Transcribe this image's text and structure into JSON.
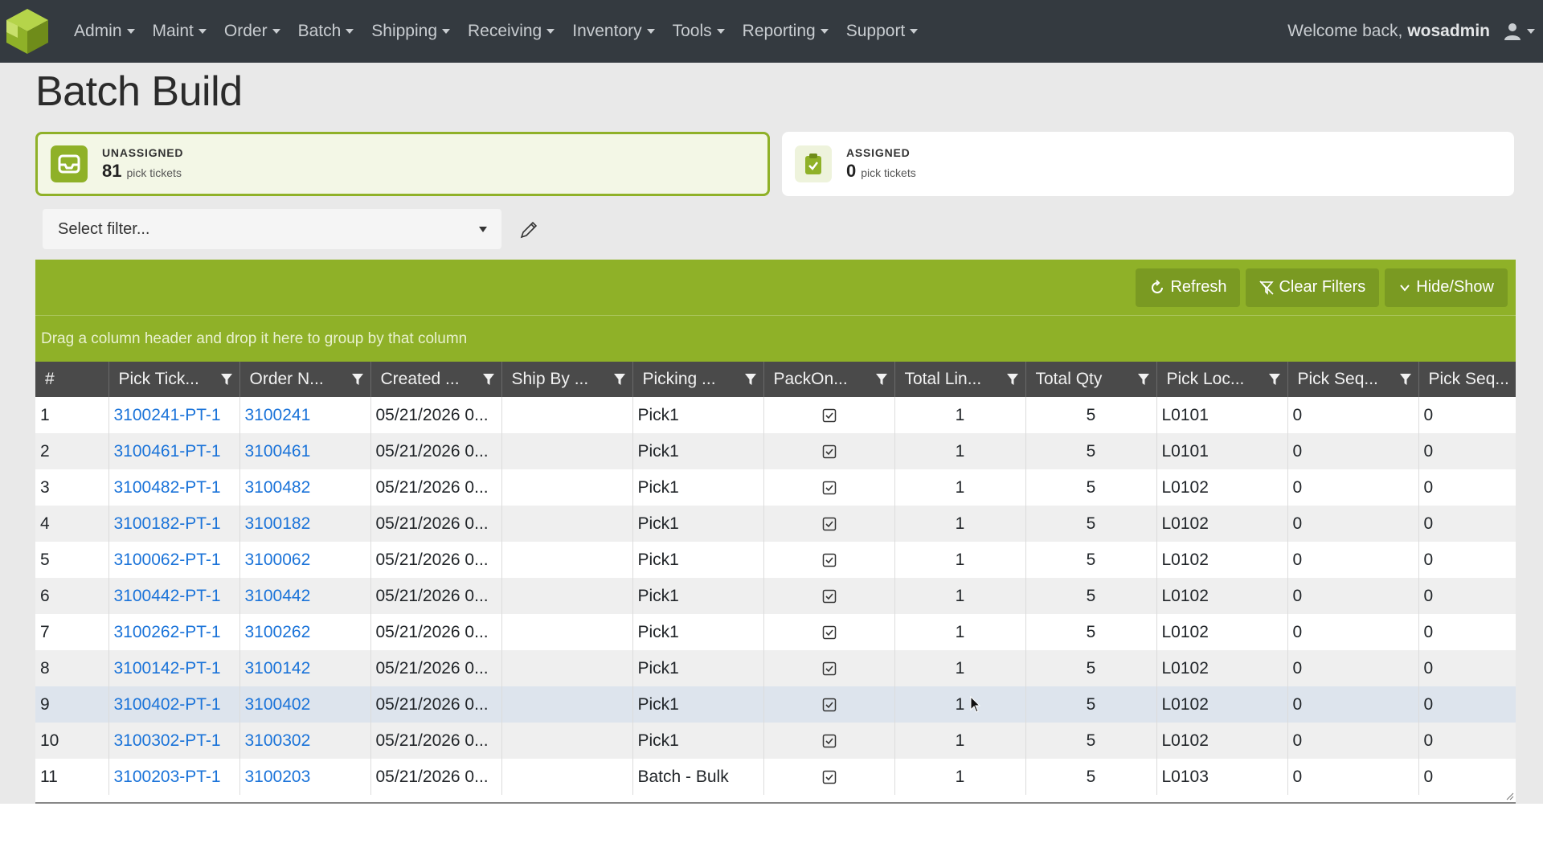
{
  "nav": {
    "items": [
      "Admin",
      "Maint",
      "Order",
      "Batch",
      "Shipping",
      "Receiving",
      "Inventory",
      "Tools",
      "Reporting",
      "Support"
    ],
    "welcome": "Welcome back,",
    "username": "wosadmin"
  },
  "page": {
    "title": "Batch Build"
  },
  "cards": {
    "unassigned": {
      "label": "UNASSIGNED",
      "count": "81",
      "unit": "pick tickets"
    },
    "assigned": {
      "label": "ASSIGNED",
      "count": "0",
      "unit": "pick tickets"
    }
  },
  "filter": {
    "placeholder": "Select filter..."
  },
  "toolbar": {
    "refresh": "Refresh",
    "clear_filters": "Clear Filters",
    "hide_show": "Hide/Show"
  },
  "group_panel": {
    "text": "Drag a column header and drop it here to group by that column"
  },
  "table": {
    "headers": [
      "#",
      "Pick Tick...",
      "Order N...",
      "Created ...",
      "Ship By ...",
      "Picking ...",
      "PackOn...",
      "Total Lin...",
      "Total Qty",
      "Pick Loc...",
      "Pick Seq...",
      "Pick Seq..."
    ],
    "rows": [
      {
        "n": "1",
        "pick": "3100241-PT-1",
        "order": "3100241",
        "created": "05/21/2026 0...",
        "ship": "",
        "picking": "Pick1",
        "lines": "1",
        "qty": "5",
        "loc": "L0101",
        "seq1": "0",
        "seq2": "0"
      },
      {
        "n": "2",
        "pick": "3100461-PT-1",
        "order": "3100461",
        "created": "05/21/2026 0...",
        "ship": "",
        "picking": "Pick1",
        "lines": "1",
        "qty": "5",
        "loc": "L0101",
        "seq1": "0",
        "seq2": "0"
      },
      {
        "n": "3",
        "pick": "3100482-PT-1",
        "order": "3100482",
        "created": "05/21/2026 0...",
        "ship": "",
        "picking": "Pick1",
        "lines": "1",
        "qty": "5",
        "loc": "L0102",
        "seq1": "0",
        "seq2": "0"
      },
      {
        "n": "4",
        "pick": "3100182-PT-1",
        "order": "3100182",
        "created": "05/21/2026 0...",
        "ship": "",
        "picking": "Pick1",
        "lines": "1",
        "qty": "5",
        "loc": "L0102",
        "seq1": "0",
        "seq2": "0"
      },
      {
        "n": "5",
        "pick": "3100062-PT-1",
        "order": "3100062",
        "created": "05/21/2026 0...",
        "ship": "",
        "picking": "Pick1",
        "lines": "1",
        "qty": "5",
        "loc": "L0102",
        "seq1": "0",
        "seq2": "0"
      },
      {
        "n": "6",
        "pick": "3100442-PT-1",
        "order": "3100442",
        "created": "05/21/2026 0...",
        "ship": "",
        "picking": "Pick1",
        "lines": "1",
        "qty": "5",
        "loc": "L0102",
        "seq1": "0",
        "seq2": "0"
      },
      {
        "n": "7",
        "pick": "3100262-PT-1",
        "order": "3100262",
        "created": "05/21/2026 0...",
        "ship": "",
        "picking": "Pick1",
        "lines": "1",
        "qty": "5",
        "loc": "L0102",
        "seq1": "0",
        "seq2": "0"
      },
      {
        "n": "8",
        "pick": "3100142-PT-1",
        "order": "3100142",
        "created": "05/21/2026 0...",
        "ship": "",
        "picking": "Pick1",
        "lines": "1",
        "qty": "5",
        "loc": "L0102",
        "seq1": "0",
        "seq2": "0"
      },
      {
        "n": "9",
        "pick": "3100402-PT-1",
        "order": "3100402",
        "created": "05/21/2026 0...",
        "ship": "",
        "picking": "Pick1",
        "lines": "1",
        "qty": "5",
        "loc": "L0102",
        "seq1": "0",
        "seq2": "0"
      },
      {
        "n": "10",
        "pick": "3100302-PT-1",
        "order": "3100302",
        "created": "05/21/2026 0...",
        "ship": "",
        "picking": "Pick1",
        "lines": "1",
        "qty": "5",
        "loc": "L0102",
        "seq1": "0",
        "seq2": "0"
      },
      {
        "n": "11",
        "pick": "3100203-PT-1",
        "order": "3100203",
        "created": "05/21/2026 0...",
        "ship": "",
        "picking": "Batch - Bulk",
        "lines": "1",
        "qty": "5",
        "loc": "L0103",
        "seq1": "0",
        "seq2": "0"
      }
    ]
  },
  "colors": {
    "navbar": "#343a40",
    "accent": "#8fb128",
    "link": "#1a73d9",
    "header": "#4a4a4a"
  },
  "icons": {
    "logo": "cube-logo-icon",
    "user": "user-icon",
    "edit": "pencil-icon",
    "filter": "filter-icon"
  }
}
